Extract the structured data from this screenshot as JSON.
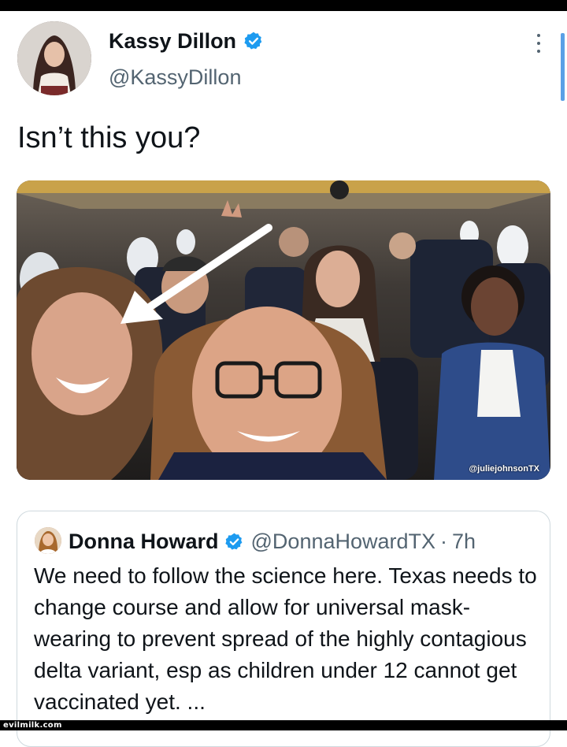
{
  "tweet": {
    "author_name": "Kassy Dillon",
    "author_handle": "@KassyDillon",
    "text": "Isn’t this you?",
    "media": {
      "photo_credit": "@juliejohnsonTX"
    }
  },
  "quoted_tweet": {
    "author_name": "Donna Howard",
    "author_handle": "@DonnaHowardTX",
    "separator": "·",
    "time": "7h",
    "text": "We need to follow the science here. Texas needs to change course and allow for universal mask-wearing to prevent spread of the highly contagious delta variant, esp as children under 12 cannot get vaccinated yet. ..."
  },
  "watermark": "evilmilk.com",
  "colors": {
    "verified_badge": "#1d9bf0",
    "text_primary": "#0f1419",
    "text_secondary": "#536471",
    "border": "#cfd9de"
  },
  "icons": {
    "verified": "verified-badge-icon",
    "more": "more-options-icon"
  }
}
